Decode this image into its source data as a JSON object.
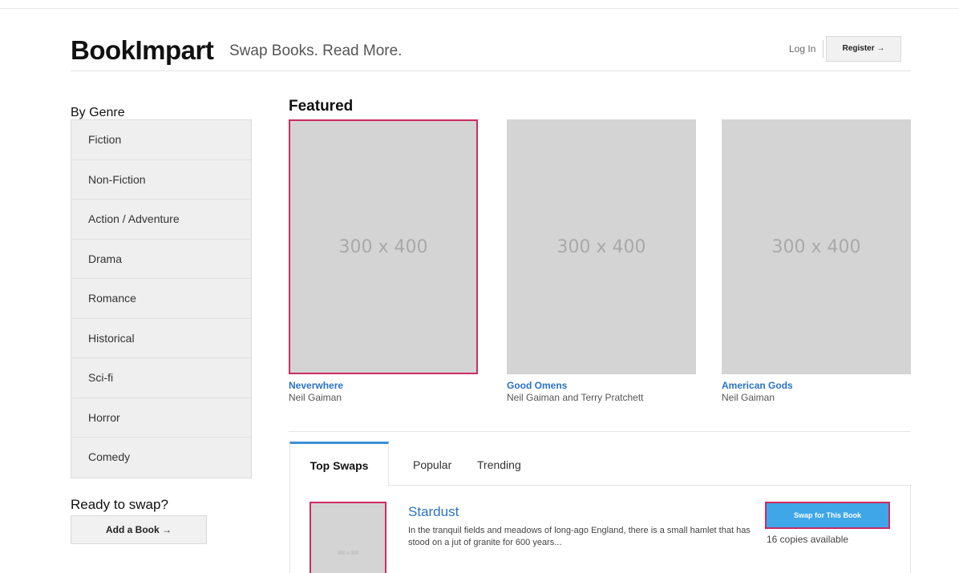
{
  "header": {
    "logo": "BookImpart",
    "tagline": "Swap Books. Read More.",
    "login_label": "Log In",
    "register_label": "Register →"
  },
  "sidebar": {
    "title": "By Genre",
    "genres": [
      "Fiction",
      "Non-Fiction",
      "Action / Adventure",
      "Drama",
      "Romance",
      "Historical",
      "Sci-fi",
      "Horror",
      "Comedy"
    ],
    "ready_title": "Ready to swap?",
    "add_book_label": "Add a Book →"
  },
  "featured": {
    "title": "Featured",
    "books": [
      {
        "placeholder": "300 x 400",
        "title": "Neverwhere",
        "author": "Neil Gaiman"
      },
      {
        "placeholder": "300 x 400",
        "title": "Good Omens",
        "author": "Neil Gaiman and Terry Pratchett"
      },
      {
        "placeholder": "300 x 400",
        "title": "American Gods",
        "author": "Neil Gaiman"
      }
    ]
  },
  "tabs": {
    "items": [
      "Top Swaps",
      "Popular",
      "Trending"
    ],
    "active": "Top Swaps"
  },
  "top_swap": {
    "thumb_placeholder": "300 x 300",
    "title": "Stardust",
    "description": "In the tranquil fields and meadows of long-ago England, there is a small hamlet that has stood on a jut of granite for 600 years...",
    "swap_button_label": "Swap for This Book",
    "copies": "16 copies available"
  },
  "colors": {
    "accent_blue": "#3a8fd4",
    "link_blue": "#2a73c6",
    "highlight_pink": "#cc2b63",
    "placeholder_gray": "#d4d4d4"
  }
}
